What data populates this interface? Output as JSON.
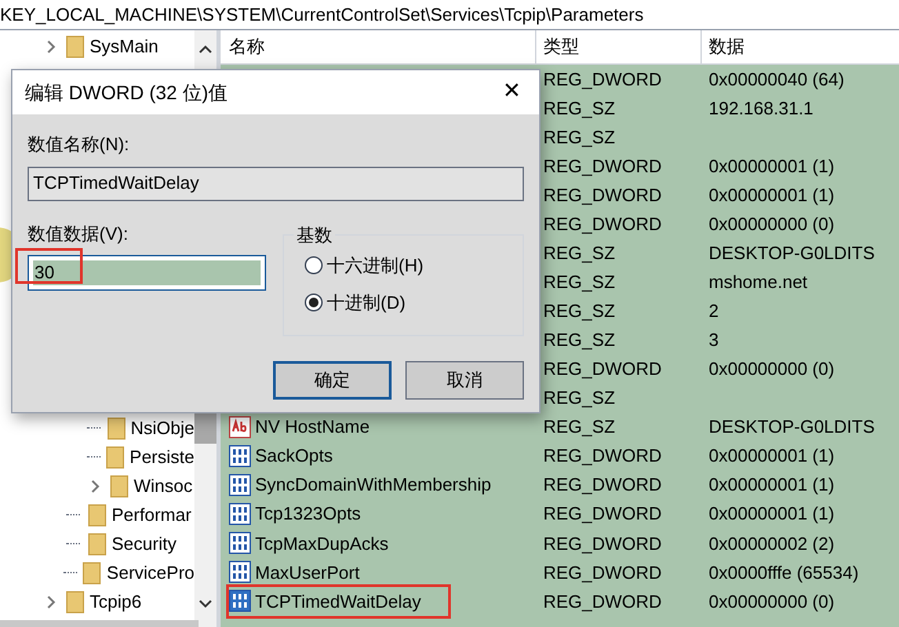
{
  "address_bar": "KEY_LOCAL_MACHINE\\SYSTEM\\CurrentControlSet\\Services\\Tcpip\\Parameters",
  "tree": {
    "items": [
      {
        "label": "SysMain",
        "has_children": true
      },
      {
        "children": [
          {
            "children": [
              {
                "label": "NsiObje",
                "has_children": false
              },
              {
                "label": "Persiste",
                "has_children": false
              },
              {
                "label": "Winsoc",
                "has_children": true
              }
            ]
          },
          {
            "label": "Performar",
            "has_children": false
          },
          {
            "label": "Security",
            "has_children": false
          },
          {
            "label": "ServicePro",
            "has_children": false
          }
        ]
      },
      {
        "label": "Tcpip6",
        "has_children": true
      }
    ]
  },
  "table": {
    "columns": [
      "名称",
      "类型",
      "数据"
    ],
    "rows": [
      {
        "type": "REG_DWORD",
        "data": "0x00000040 (64)"
      },
      {
        "type": "REG_SZ",
        "data": "192.168.31.1"
      },
      {
        "type": "REG_SZ"
      },
      {
        "type": "REG_DWORD",
        "data": "0x00000001 (1)"
      },
      {
        "type": "REG_DWORD",
        "data": "0x00000001 (1)"
      },
      {
        "type": "REG_DWORD",
        "data": "0x00000000 (0)"
      },
      {
        "type": "REG_SZ",
        "data": "DESKTOP-G0LDITS"
      },
      {
        "type": "REG_SZ",
        "data": "mshome.net"
      },
      {
        "type": "REG_SZ",
        "data": "2"
      },
      {
        "type": "REG_SZ",
        "data": "3"
      },
      {
        "type": "REG_DWORD",
        "data": "0x00000000 (0)"
      },
      {
        "type": "REG_SZ"
      },
      {
        "kind": "string",
        "name": "NV HostName",
        "type": "REG_SZ",
        "data": "DESKTOP-G0LDITS",
        "selected": false,
        "annotated": false
      },
      {
        "kind": "binary",
        "name": "SackOpts",
        "type": "REG_DWORD",
        "data": "0x00000001 (1)",
        "selected": false,
        "annotated": false
      },
      {
        "kind": "binary",
        "name": "SyncDomainWithMembership",
        "type": "REG_DWORD",
        "data": "0x00000001 (1)",
        "selected": false,
        "annotated": false
      },
      {
        "kind": "binary",
        "name": "Tcp1323Opts",
        "type": "REG_DWORD",
        "data": "0x00000001 (1)",
        "selected": false,
        "annotated": false
      },
      {
        "kind": "binary",
        "name": "TcpMaxDupAcks",
        "type": "REG_DWORD",
        "data": "0x00000002 (2)",
        "selected": false,
        "annotated": false
      },
      {
        "kind": "binary",
        "name": "MaxUserPort",
        "type": "REG_DWORD",
        "data": "0x0000fffe (65534)",
        "selected": false,
        "annotated": false
      },
      {
        "kind": "binary",
        "name": "TCPTimedWaitDelay",
        "type": "REG_DWORD",
        "data": "0x00000000 (0)",
        "selected": true,
        "annotated": true
      }
    ]
  },
  "dialog": {
    "title": "编辑 DWORD (32 位)值",
    "close": "✕",
    "name_label": "数值名称(N):",
    "name_value": "TCPTimedWaitDelay",
    "data_label": "数值数据(V):",
    "data_value": "30",
    "data_annotated": true,
    "base_group": {
      "title": "基数",
      "options": [
        {
          "label": "十六进制(H)",
          "selected": false
        },
        {
          "label": "十进制(D)",
          "selected": true
        }
      ]
    },
    "buttons": [
      {
        "label": "确定",
        "default": true
      },
      {
        "label": "取消",
        "default": false
      }
    ]
  }
}
